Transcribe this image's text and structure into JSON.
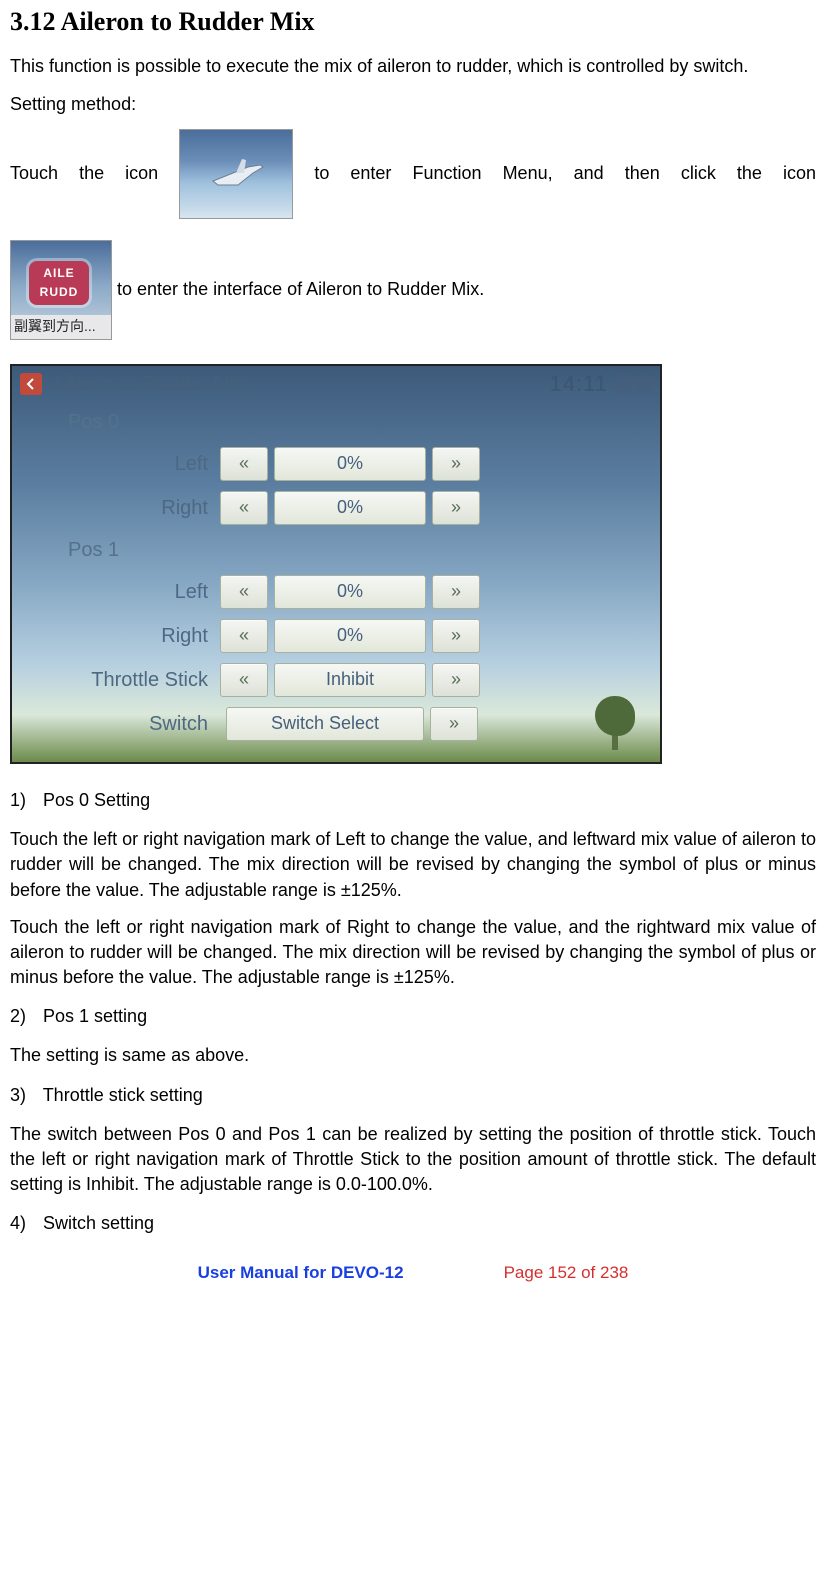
{
  "heading": "3.12 Aileron to Rudder Mix",
  "intro": "This function is possible to execute the mix of aileron to rudder, which is controlled by switch.",
  "setting_method_label": "Setting method:",
  "line1_a": "Touch the icon ",
  "line1_b": " to enter Function Menu, and then click the icon",
  "icon2_caption": "副翼到方向...",
  "line2_b": " to enter the interface of Aileron to Rudder Mix.",
  "screen": {
    "title": "Aileron to Rudder Mix",
    "clock": "14:11",
    "pos0": "Pos 0",
    "pos1": "Pos 1",
    "left_label": "Left",
    "right_label": "Right",
    "throttle_label": "Throttle Stick",
    "switch_label": "Switch",
    "pos0_left": "0%",
    "pos0_right": "0%",
    "pos1_left": "0%",
    "pos1_right": "0%",
    "throttle_value": "Inhibit",
    "switch_value": "Switch Select",
    "arrow_left": "«",
    "arrow_right": "»"
  },
  "steps": {
    "s1_num": "1)",
    "s1_title": "Pos 0 Setting",
    "s1_p1": "Touch the left or right navigation mark of Left to change the value, and leftward mix value of aileron to rudder will be changed. The mix direction will be revised by changing the symbol of plus or minus before the value. The adjustable range is ±125%.",
    "s1_p2": "Touch the left or right navigation mark of Right to change the value, and the rightward mix value of aileron to rudder will be changed. The mix direction will be revised by changing the symbol of plus or minus before the value. The adjustable range is ±125%.",
    "s2_num": "2)",
    "s2_title": "Pos 1 setting",
    "s2_p1": "The setting is same as above.",
    "s3_num": "3)",
    "s3_title": "Throttle stick setting",
    "s3_p1": "The switch between Pos 0 and Pos 1 can be realized by setting the position of throttle stick. Touch the left or right navigation mark of Throttle Stick to the position amount of throttle stick. The default setting is Inhibit. The adjustable range is 0.0-100.0%.",
    "s4_num": "4)",
    "s4_title": "Switch setting"
  },
  "footer": {
    "manual": "User Manual for DEVO-12",
    "page": "Page 152 of 238"
  }
}
